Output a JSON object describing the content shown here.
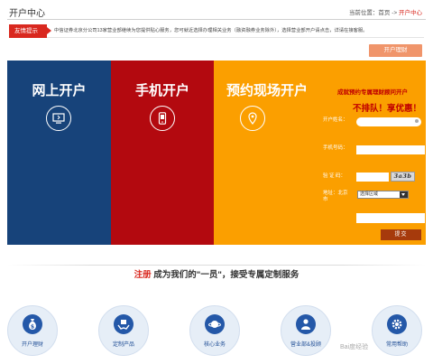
{
  "header": {
    "title": "开户中心",
    "breadcrumb_prefix": "当前位置：",
    "breadcrumb_home": "首页",
    "breadcrumb_sep": " -> ",
    "breadcrumb_current": "开户中心"
  },
  "notice": {
    "tag": "友情提示",
    "text": "中信证券北京分公司13家营业部继续为您提供贴心服务，您可就近选择办理相关业务（融资融券业务除外），选择营业部开户请点击，详请在接客服。"
  },
  "online_account_button": "开户理财",
  "banner": {
    "online": "网上开户",
    "mobile": "手机开户",
    "onsite": "预约现场开户"
  },
  "form": {
    "title": "成就预约专属理财顾问开户",
    "slogan": "不排队！享优惠！",
    "name_label": "开户姓名：",
    "phone_label": "手机号码：",
    "captcha_label": "验 证 码：",
    "captcha_text": "3a3b",
    "area_label": "地址：北京市",
    "area_select": "选择区域",
    "submit": "提交"
  },
  "invite": {
    "register": "注册",
    "rest": " 成为我们的\"一员\"，接受专属定制服务"
  },
  "services": [
    {
      "label": "开户理财",
      "icon": "money-bag-icon"
    },
    {
      "label": "定制产品",
      "icon": "hands-gift-icon"
    },
    {
      "label": "核心业务",
      "icon": "planet-icon"
    },
    {
      "label": "营业部&投顾",
      "icon": "advisor-icon"
    },
    {
      "label": "常用帮助",
      "icon": "gear-icon"
    }
  ],
  "watermark": "Bai度经验",
  "colors": {
    "blue": "#17437a",
    "red": "#b3090f",
    "orange": "#fb9f00",
    "accent": "#d9281f"
  }
}
